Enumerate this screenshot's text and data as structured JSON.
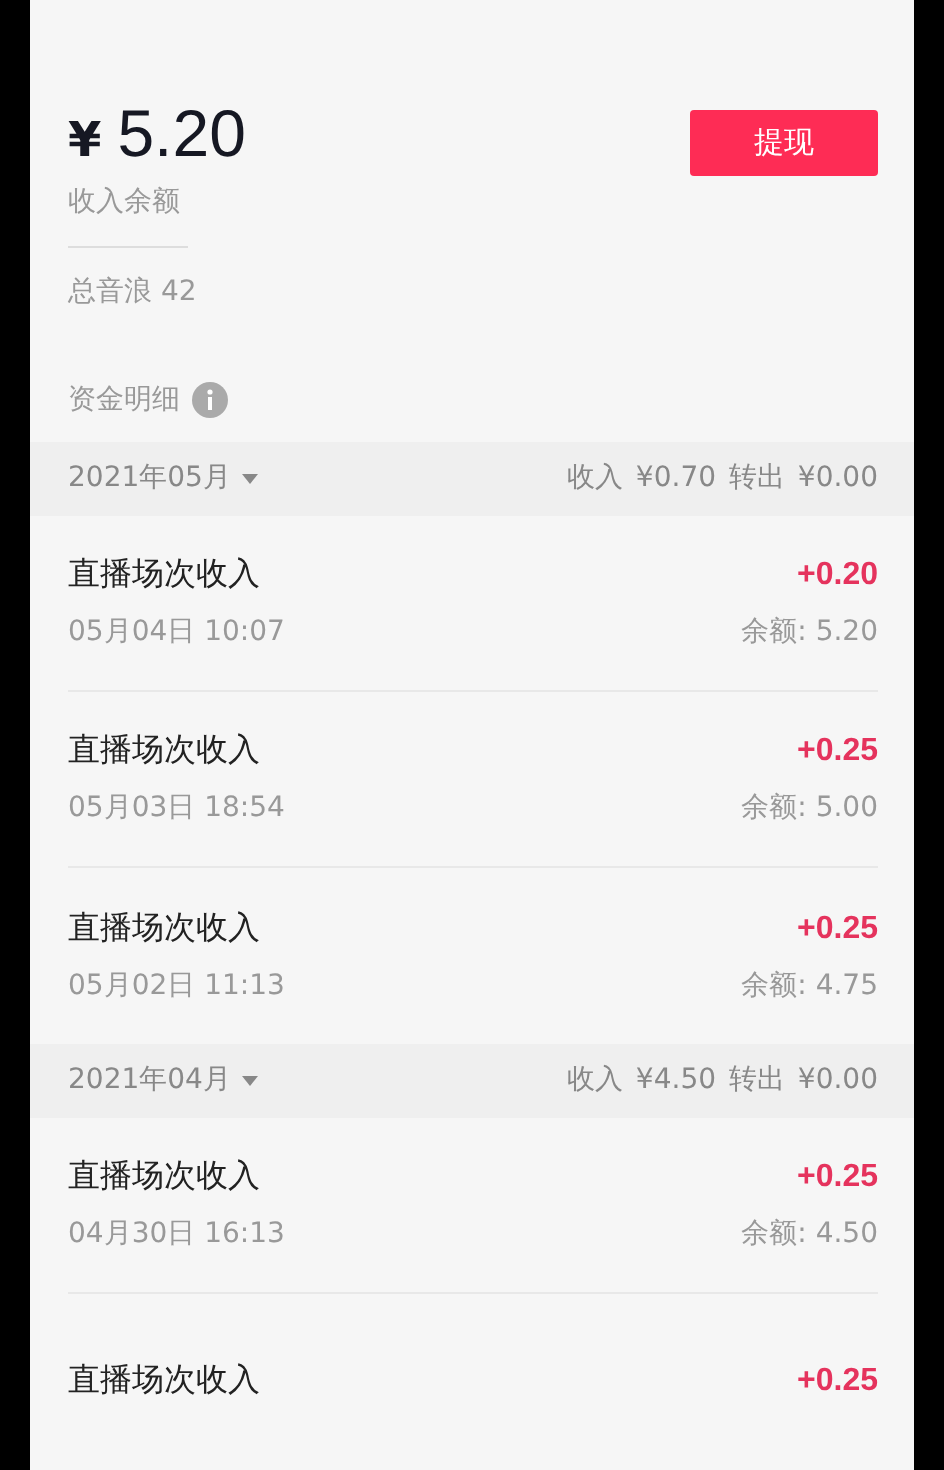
{
  "balance": {
    "currency": "¥",
    "amount": "5.20",
    "label": "收入余额"
  },
  "withdraw_button": "提现",
  "total_sound_waves": "总音浪 42",
  "details_title": "资金明细",
  "months": [
    {
      "month": "2021年05月",
      "income": "收入 ¥0.70",
      "transfer_out": "转出 ¥0.00",
      "entries": [
        {
          "title": "直播场次收入",
          "amount": "+0.20",
          "time": "05月04日 10:07",
          "balance": "余额: 5.20"
        },
        {
          "title": "直播场次收入",
          "amount": "+0.25",
          "time": "05月03日 18:54",
          "balance": "余额: 5.00"
        },
        {
          "title": "直播场次收入",
          "amount": "+0.25",
          "time": "05月02日 11:13",
          "balance": "余额: 4.75"
        }
      ]
    },
    {
      "month": "2021年04月",
      "income": "收入 ¥4.50",
      "transfer_out": "转出 ¥0.00",
      "entries": [
        {
          "title": "直播场次收入",
          "amount": "+0.25",
          "time": "04月30日 16:13",
          "balance": "余额: 4.50"
        },
        {
          "title": "直播场次收入",
          "amount": "+0.25"
        }
      ]
    }
  ]
}
